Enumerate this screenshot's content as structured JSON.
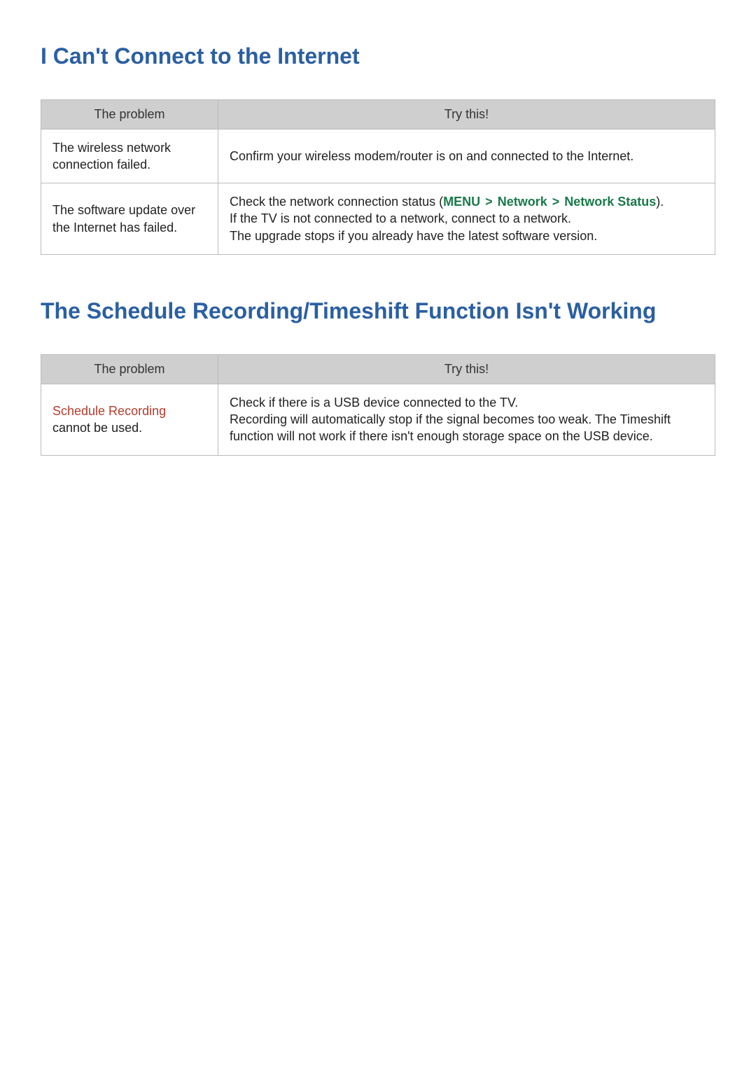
{
  "section1": {
    "title": "I Can't Connect to the Internet",
    "headers": {
      "problem": "The problem",
      "try": "Try this!"
    },
    "rows": [
      {
        "problem": "The wireless network connection failed.",
        "try_plain": "Confirm your wireless modem/router is on and connected to the Internet."
      },
      {
        "problem": "The software update over the Internet has failed.",
        "try_prefix": "Check the network connection status (",
        "menu": {
          "a": "MENU",
          "b": "Network",
          "c": "Network Status"
        },
        "try_mid": ").",
        "try_line2": "If the TV is not connected to a network, connect to a network.",
        "try_line3": "The upgrade stops if you already have the latest software version."
      }
    ]
  },
  "section2": {
    "title": "The Schedule Recording/Timeshift Function Isn't Working",
    "headers": {
      "problem": "The problem",
      "try": "Try this!"
    },
    "rows": [
      {
        "problem_highlight": "Schedule Recording",
        "problem_rest": " cannot be used.",
        "try_line1": "Check if there is a USB device connected to the TV.",
        "try_line2": "Recording will automatically stop if the signal becomes too weak. The Timeshift function will not work if there isn't enough storage space on the USB device."
      }
    ]
  },
  "arrow": ">"
}
